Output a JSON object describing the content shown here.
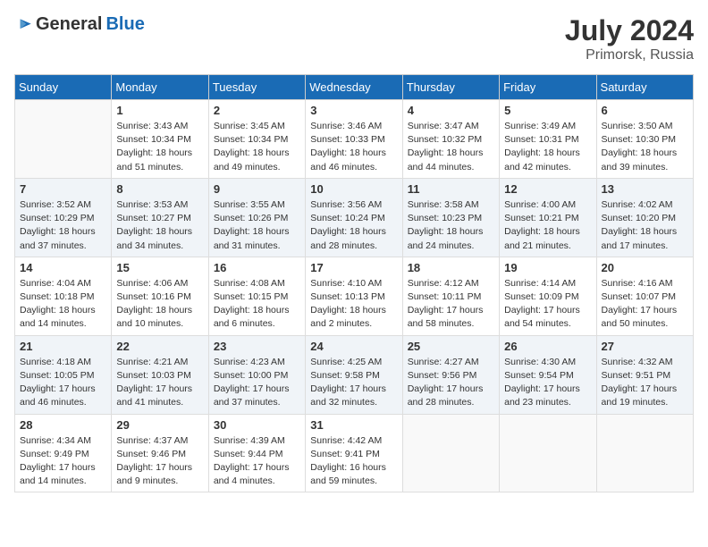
{
  "header": {
    "logo_general": "General",
    "logo_blue": "Blue",
    "month_year": "July 2024",
    "location": "Primorsk, Russia"
  },
  "weekdays": [
    "Sunday",
    "Monday",
    "Tuesday",
    "Wednesday",
    "Thursday",
    "Friday",
    "Saturday"
  ],
  "weeks": [
    [
      {
        "day": "",
        "sunrise": "",
        "sunset": "",
        "daylight": ""
      },
      {
        "day": "1",
        "sunrise": "Sunrise: 3:43 AM",
        "sunset": "Sunset: 10:34 PM",
        "daylight": "Daylight: 18 hours and 51 minutes."
      },
      {
        "day": "2",
        "sunrise": "Sunrise: 3:45 AM",
        "sunset": "Sunset: 10:34 PM",
        "daylight": "Daylight: 18 hours and 49 minutes."
      },
      {
        "day": "3",
        "sunrise": "Sunrise: 3:46 AM",
        "sunset": "Sunset: 10:33 PM",
        "daylight": "Daylight: 18 hours and 46 minutes."
      },
      {
        "day": "4",
        "sunrise": "Sunrise: 3:47 AM",
        "sunset": "Sunset: 10:32 PM",
        "daylight": "Daylight: 18 hours and 44 minutes."
      },
      {
        "day": "5",
        "sunrise": "Sunrise: 3:49 AM",
        "sunset": "Sunset: 10:31 PM",
        "daylight": "Daylight: 18 hours and 42 minutes."
      },
      {
        "day": "6",
        "sunrise": "Sunrise: 3:50 AM",
        "sunset": "Sunset: 10:30 PM",
        "daylight": "Daylight: 18 hours and 39 minutes."
      }
    ],
    [
      {
        "day": "7",
        "sunrise": "Sunrise: 3:52 AM",
        "sunset": "Sunset: 10:29 PM",
        "daylight": "Daylight: 18 hours and 37 minutes."
      },
      {
        "day": "8",
        "sunrise": "Sunrise: 3:53 AM",
        "sunset": "Sunset: 10:27 PM",
        "daylight": "Daylight: 18 hours and 34 minutes."
      },
      {
        "day": "9",
        "sunrise": "Sunrise: 3:55 AM",
        "sunset": "Sunset: 10:26 PM",
        "daylight": "Daylight: 18 hours and 31 minutes."
      },
      {
        "day": "10",
        "sunrise": "Sunrise: 3:56 AM",
        "sunset": "Sunset: 10:24 PM",
        "daylight": "Daylight: 18 hours and 28 minutes."
      },
      {
        "day": "11",
        "sunrise": "Sunrise: 3:58 AM",
        "sunset": "Sunset: 10:23 PM",
        "daylight": "Daylight: 18 hours and 24 minutes."
      },
      {
        "day": "12",
        "sunrise": "Sunrise: 4:00 AM",
        "sunset": "Sunset: 10:21 PM",
        "daylight": "Daylight: 18 hours and 21 minutes."
      },
      {
        "day": "13",
        "sunrise": "Sunrise: 4:02 AM",
        "sunset": "Sunset: 10:20 PM",
        "daylight": "Daylight: 18 hours and 17 minutes."
      }
    ],
    [
      {
        "day": "14",
        "sunrise": "Sunrise: 4:04 AM",
        "sunset": "Sunset: 10:18 PM",
        "daylight": "Daylight: 18 hours and 14 minutes."
      },
      {
        "day": "15",
        "sunrise": "Sunrise: 4:06 AM",
        "sunset": "Sunset: 10:16 PM",
        "daylight": "Daylight: 18 hours and 10 minutes."
      },
      {
        "day": "16",
        "sunrise": "Sunrise: 4:08 AM",
        "sunset": "Sunset: 10:15 PM",
        "daylight": "Daylight: 18 hours and 6 minutes."
      },
      {
        "day": "17",
        "sunrise": "Sunrise: 4:10 AM",
        "sunset": "Sunset: 10:13 PM",
        "daylight": "Daylight: 18 hours and 2 minutes."
      },
      {
        "day": "18",
        "sunrise": "Sunrise: 4:12 AM",
        "sunset": "Sunset: 10:11 PM",
        "daylight": "Daylight: 17 hours and 58 minutes."
      },
      {
        "day": "19",
        "sunrise": "Sunrise: 4:14 AM",
        "sunset": "Sunset: 10:09 PM",
        "daylight": "Daylight: 17 hours and 54 minutes."
      },
      {
        "day": "20",
        "sunrise": "Sunrise: 4:16 AM",
        "sunset": "Sunset: 10:07 PM",
        "daylight": "Daylight: 17 hours and 50 minutes."
      }
    ],
    [
      {
        "day": "21",
        "sunrise": "Sunrise: 4:18 AM",
        "sunset": "Sunset: 10:05 PM",
        "daylight": "Daylight: 17 hours and 46 minutes."
      },
      {
        "day": "22",
        "sunrise": "Sunrise: 4:21 AM",
        "sunset": "Sunset: 10:03 PM",
        "daylight": "Daylight: 17 hours and 41 minutes."
      },
      {
        "day": "23",
        "sunrise": "Sunrise: 4:23 AM",
        "sunset": "Sunset: 10:00 PM",
        "daylight": "Daylight: 17 hours and 37 minutes."
      },
      {
        "day": "24",
        "sunrise": "Sunrise: 4:25 AM",
        "sunset": "Sunset: 9:58 PM",
        "daylight": "Daylight: 17 hours and 32 minutes."
      },
      {
        "day": "25",
        "sunrise": "Sunrise: 4:27 AM",
        "sunset": "Sunset: 9:56 PM",
        "daylight": "Daylight: 17 hours and 28 minutes."
      },
      {
        "day": "26",
        "sunrise": "Sunrise: 4:30 AM",
        "sunset": "Sunset: 9:54 PM",
        "daylight": "Daylight: 17 hours and 23 minutes."
      },
      {
        "day": "27",
        "sunrise": "Sunrise: 4:32 AM",
        "sunset": "Sunset: 9:51 PM",
        "daylight": "Daylight: 17 hours and 19 minutes."
      }
    ],
    [
      {
        "day": "28",
        "sunrise": "Sunrise: 4:34 AM",
        "sunset": "Sunset: 9:49 PM",
        "daylight": "Daylight: 17 hours and 14 minutes."
      },
      {
        "day": "29",
        "sunrise": "Sunrise: 4:37 AM",
        "sunset": "Sunset: 9:46 PM",
        "daylight": "Daylight: 17 hours and 9 minutes."
      },
      {
        "day": "30",
        "sunrise": "Sunrise: 4:39 AM",
        "sunset": "Sunset: 9:44 PM",
        "daylight": "Daylight: 17 hours and 4 minutes."
      },
      {
        "day": "31",
        "sunrise": "Sunrise: 4:42 AM",
        "sunset": "Sunset: 9:41 PM",
        "daylight": "Daylight: 16 hours and 59 minutes."
      },
      {
        "day": "",
        "sunrise": "",
        "sunset": "",
        "daylight": ""
      },
      {
        "day": "",
        "sunrise": "",
        "sunset": "",
        "daylight": ""
      },
      {
        "day": "",
        "sunrise": "",
        "sunset": "",
        "daylight": ""
      }
    ]
  ]
}
